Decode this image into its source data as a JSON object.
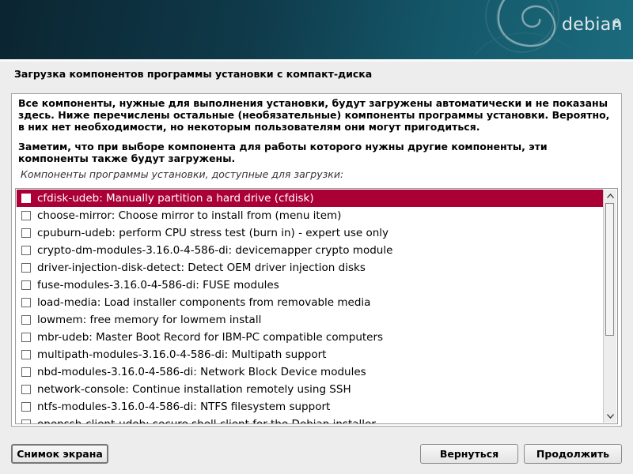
{
  "banner": {
    "logo_text": "debian",
    "logo_version": "8"
  },
  "page": {
    "title": "Загрузка компонентов программы установки с компакт-диска"
  },
  "content": {
    "paragraph1": "Все компоненты, нужные для выполнения установки, будут загружены автоматически и не показаны здесь. Ниже перечислены остальные (необязательные) компоненты программы установки. Вероятно, в них нет необходимости, но некоторым пользователям они могут пригодиться.",
    "paragraph2": "Заметим, что при выборе компонента для работы которого нужны другие компоненты, эти компоненты также будут загружены.",
    "list_label": "Компоненты программы установки, доступные для загрузки:"
  },
  "components": [
    {
      "label": "cfdisk-udeb: Manually partition a hard drive (cfdisk)",
      "checked": false,
      "selected": true
    },
    {
      "label": "choose-mirror: Choose mirror to install from (menu item)",
      "checked": false,
      "selected": false
    },
    {
      "label": "cpuburn-udeb: perform CPU stress test (burn in) - expert use only",
      "checked": false,
      "selected": false
    },
    {
      "label": "crypto-dm-modules-3.16.0-4-586-di: devicemapper crypto module",
      "checked": false,
      "selected": false
    },
    {
      "label": "driver-injection-disk-detect: Detect OEM driver injection disks",
      "checked": false,
      "selected": false
    },
    {
      "label": "fuse-modules-3.16.0-4-586-di: FUSE modules",
      "checked": false,
      "selected": false
    },
    {
      "label": "load-media: Load installer components from removable media",
      "checked": false,
      "selected": false
    },
    {
      "label": "lowmem: free memory for lowmem install",
      "checked": false,
      "selected": false
    },
    {
      "label": "mbr-udeb: Master Boot Record for IBM-PC compatible computers",
      "checked": false,
      "selected": false
    },
    {
      "label": "multipath-modules-3.16.0-4-586-di: Multipath support",
      "checked": false,
      "selected": false
    },
    {
      "label": "nbd-modules-3.16.0-4-586-di: Network Block Device modules",
      "checked": false,
      "selected": false
    },
    {
      "label": "network-console: Continue installation remotely using SSH",
      "checked": false,
      "selected": false
    },
    {
      "label": "ntfs-modules-3.16.0-4-586-di: NTFS filesystem support",
      "checked": false,
      "selected": false
    },
    {
      "label": "openssh-client-udeb: secure shell client for the Debian installer",
      "checked": false,
      "selected": false
    }
  ],
  "buttons": {
    "screenshot": "Снимок экрана",
    "back": "Вернуться",
    "continue": "Продолжить"
  },
  "colors": {
    "selection": "#ab0036",
    "banner": "#0f3a4a"
  },
  "icons": {
    "scroll_up": "chevron-up-icon",
    "scroll_down": "chevron-down-icon",
    "checkbox": "checkbox-icon"
  }
}
